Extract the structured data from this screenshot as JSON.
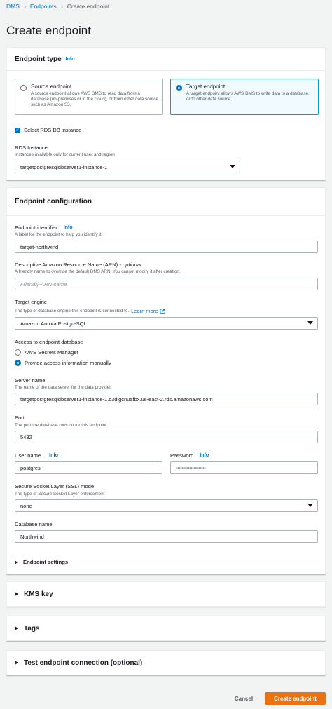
{
  "breadcrumb": {
    "items": [
      "DMS",
      "Endpoints"
    ],
    "current": "Create endpoint"
  },
  "page_title": "Create endpoint",
  "endpoint_type": {
    "header": "Endpoint type",
    "info": "Info",
    "source": {
      "title": "Source endpoint",
      "description": "A source endpoint allows AWS DMS to read data from a database (on-premises or in the cloud), or from other data source such as Amazon S3."
    },
    "target": {
      "title": "Target endpoint",
      "description": "A target endpoint allows AWS DMS to write data to a database, or to other data source."
    },
    "selected": "target",
    "select_rds_label": "Select RDS DB instance",
    "rds_checked": true,
    "rds_instance_label": "RDS Instance",
    "rds_instance_desc": "Instances available only for current user and region",
    "rds_instance_value": "targetpostgresqldbserver1-instance-1"
  },
  "endpoint_config": {
    "header": "Endpoint configuration",
    "identifier_label": "Endpoint identifier",
    "identifier_info": "Info",
    "identifier_desc": "A label for the endpoint to help you identify it.",
    "identifier_value": "target-northwind",
    "arn_label": "Descriptive Amazon Resource Name (ARN)",
    "arn_optional": " - optional",
    "arn_desc": "A friendly name to override the default DMS ARN. You cannot modify it after creation.",
    "arn_placeholder": "Friendly-ARN-name",
    "engine_label": "Target engine",
    "engine_desc": "The type of database engine this endpoint is connected to.",
    "engine_learn_more": "Learn more",
    "engine_value": "Amazon Aurora PostgreSQL",
    "access_label": "Access to endpoint database",
    "access_options": [
      "AWS Secrets Manager",
      "Provide access information manually"
    ],
    "access_selected": 1,
    "server_label": "Server name",
    "server_desc": "The name of the data server for the data provider.",
    "server_value": "targetpostgresqldbserver1-instance-1.c3dlgcnuafbx.us-east-2.rds.amazonaws.com",
    "port_label": "Port",
    "port_desc": "The port the database runs on for this endpoint.",
    "port_value": "5432",
    "username_label": "User name",
    "username_info": "Info",
    "username_value": "postgres",
    "password_label": "Password",
    "password_info": "Info",
    "password_value": "••••••••••••••••••••",
    "ssl_label": "Secure Socket Layer (SSL) mode",
    "ssl_desc": "The type of Secure Socket Layer enforcement",
    "ssl_value": "none",
    "dbname_label": "Database name",
    "dbname_value": "Northwind",
    "settings_label": "Endpoint settings"
  },
  "kms_key": "KMS key",
  "tags": "Tags",
  "test_connection": "Test endpoint connection (optional)",
  "actions": {
    "cancel": "Cancel",
    "create": "Create endpoint"
  },
  "colors": {
    "accent": "#0073bb",
    "primary_button": "#ec7211",
    "selected_tile_bg": "#f1faff"
  }
}
